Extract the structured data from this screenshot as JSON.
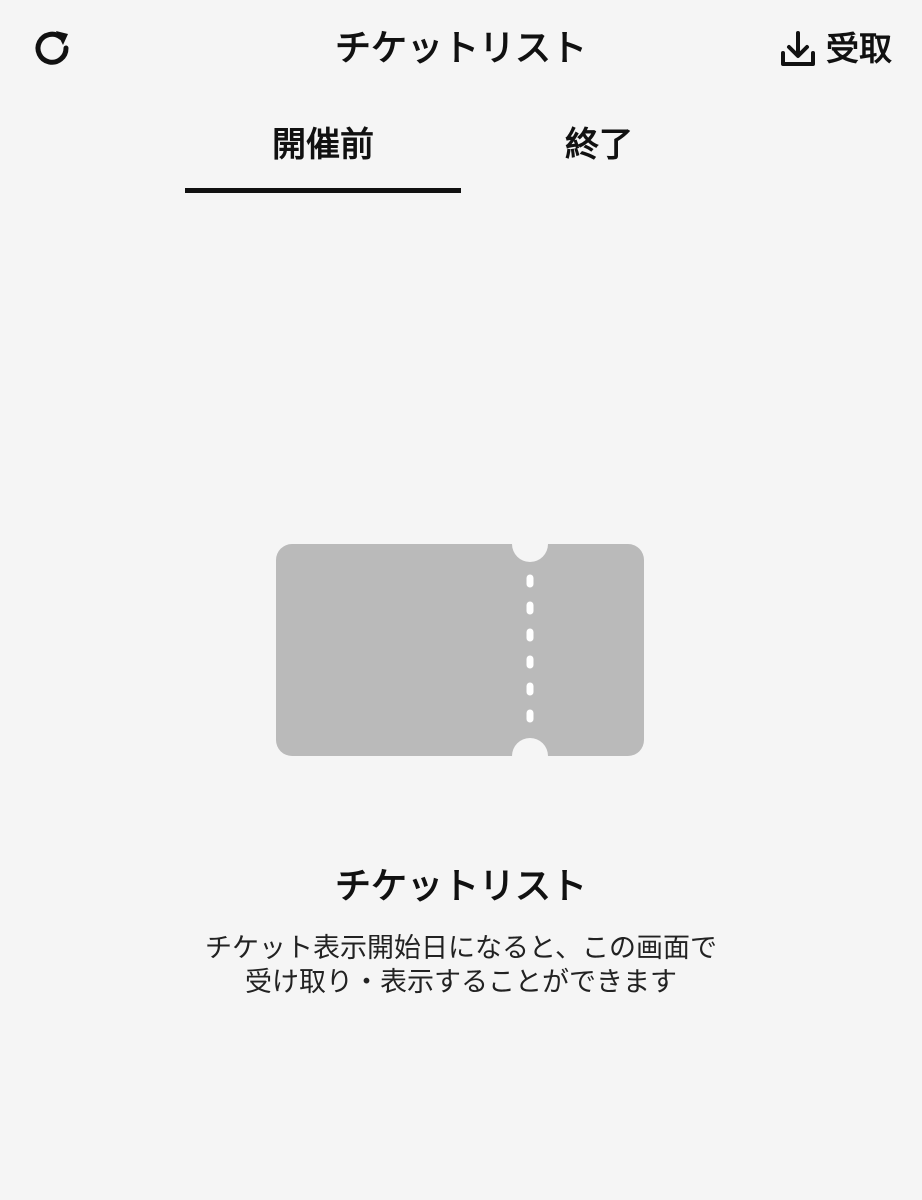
{
  "header": {
    "title": "チケットリスト",
    "refresh_icon": "refresh-icon",
    "receive_icon": "download-icon",
    "receive_label": "受取"
  },
  "tabs": [
    {
      "label": "開催前",
      "selected": true
    },
    {
      "label": "終了",
      "selected": false
    }
  ],
  "empty_state": {
    "icon": "ticket-icon",
    "title": "チケットリスト",
    "description_line1": "チケット表示開始日になると、この画面で",
    "description_line2": "受け取り・表示することができます"
  },
  "colors": {
    "background": "#f5f5f5",
    "text": "#111111",
    "ticket_fill": "#bababa",
    "indicator": "#111111"
  }
}
